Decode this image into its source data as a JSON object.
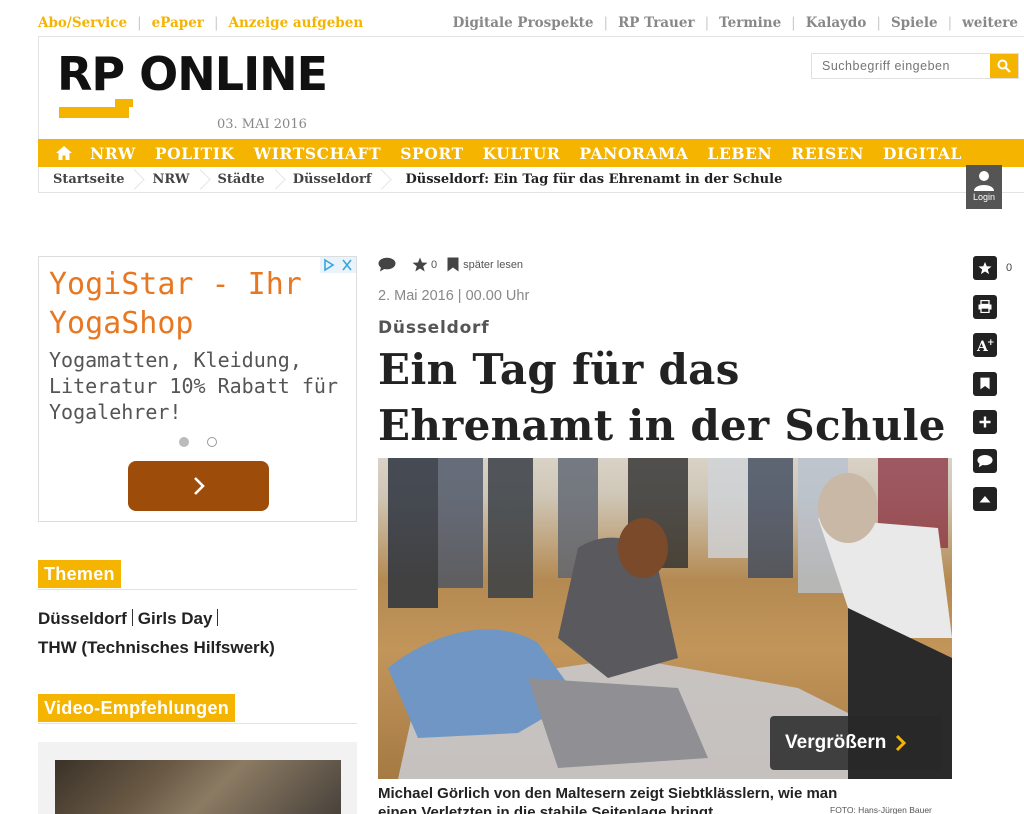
{
  "util": {
    "left": [
      "Abo/Service",
      "ePaper",
      "Anzeige aufgeben"
    ],
    "right": [
      "Digitale Prospekte",
      "RP Trauer",
      "Termine",
      "Kalaydo",
      "Spiele",
      "weitere"
    ]
  },
  "header": {
    "logo": "RP ONLINE",
    "date": "03. MAI 2016",
    "search_placeholder": "Suchbegriff eingeben",
    "login_label": "Login"
  },
  "nav": {
    "items": [
      "NRW",
      "POLITIK",
      "WIRTSCHAFT",
      "SPORT",
      "KULTUR",
      "PANORAMA",
      "LEBEN",
      "REISEN",
      "DIGITAL"
    ]
  },
  "breadcrumb": [
    "Startseite",
    "NRW",
    "Städte",
    "Düsseldorf",
    "Düsseldorf: Ein Tag für das Ehrenamt in der Schule"
  ],
  "ad": {
    "title": "YogiStar - Ihr YogaShop",
    "text": "Yogamatten, Kleidung, Literatur 10% Rabatt für Yogalehrer!",
    "slide_index": 1,
    "slide_total": 2
  },
  "themen": {
    "heading": "Themen",
    "items": [
      "Düsseldorf",
      "Girls Day",
      "THW (Technisches Hilfswerk)"
    ]
  },
  "video": {
    "heading": "Video-Empfehlungen"
  },
  "article": {
    "star_count": "0",
    "read_later": "später lesen",
    "date": "2. Mai 2016 | 00.00 Uhr",
    "kicker": "Düsseldorf",
    "headline": "Ein Tag für das Ehrenamt in der Schule",
    "enlarge": "Vergrößern",
    "caption": "Michael Görlich von den Maltesern zeigt Siebtklässlern, wie man einen Verletzten in die stabile Seitenlage bringt.",
    "credit": "FOTO: Hans-Jürgen Bauer"
  },
  "tools": {
    "star_count": "0",
    "items": [
      "star-icon",
      "print-icon",
      "font-size-icon",
      "bookmark-icon",
      "plus-icon",
      "comment-icon",
      "scroll-up-icon"
    ]
  },
  "colors": {
    "accent": "#f5b400",
    "ad_title": "#e87722",
    "ad_button": "#9e4c0a"
  }
}
